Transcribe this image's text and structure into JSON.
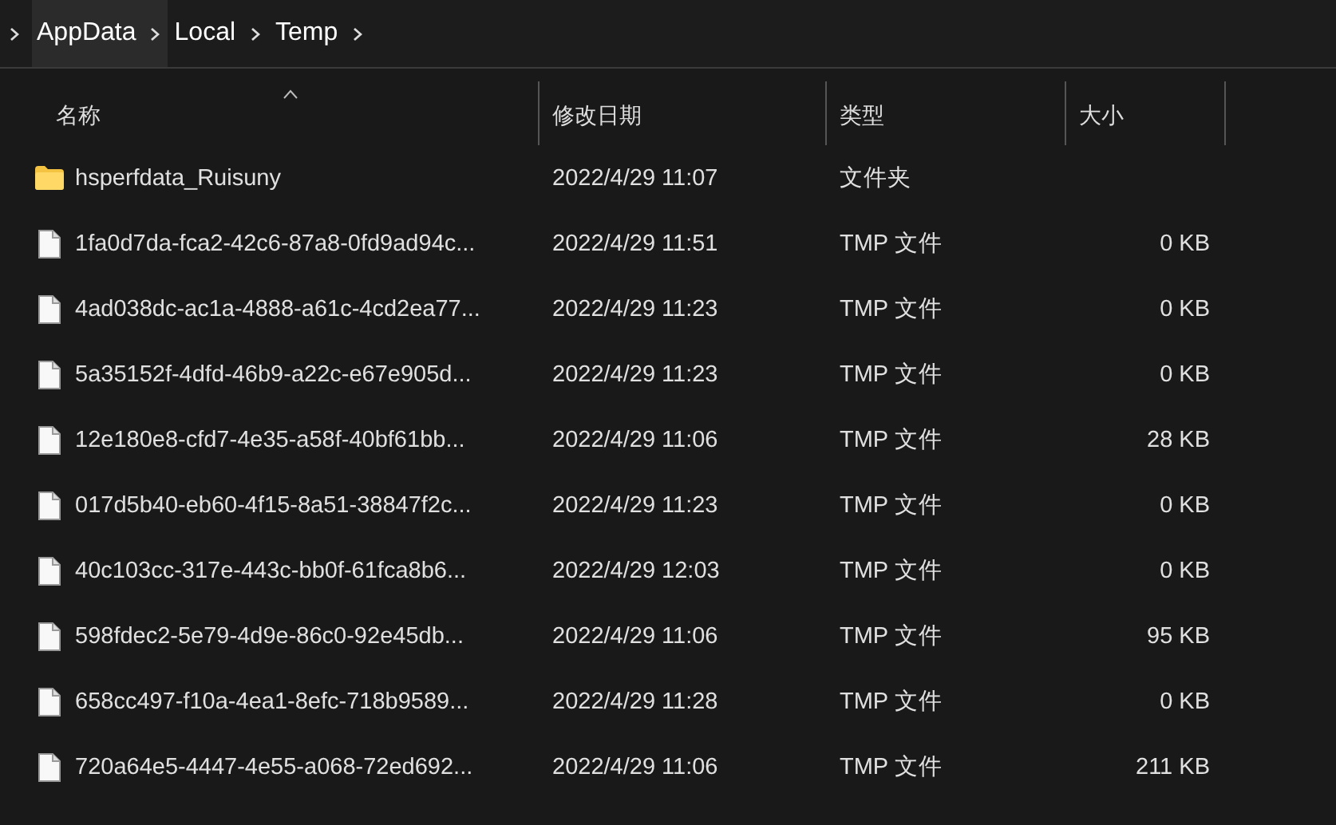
{
  "breadcrumb": [
    {
      "label": "AppData"
    },
    {
      "label": "Local"
    },
    {
      "label": "Temp"
    }
  ],
  "columns": [
    {
      "label": "名称",
      "sorted": true
    },
    {
      "label": "修改日期",
      "sorted": false
    },
    {
      "label": "类型",
      "sorted": false
    },
    {
      "label": "大小",
      "sorted": false
    }
  ],
  "rows": [
    {
      "kind": "folder",
      "name": "hsperfdata_Ruisuny",
      "modified": "2022/4/29 11:07",
      "type": "文件夹"
    },
    {
      "kind": "file",
      "name": "1fa0d7da-fca2-42c6-87a8-0fd9ad94c...",
      "modified": "2022/4/29 11:51",
      "type": "TMP 文件",
      "size": "0 KB"
    },
    {
      "kind": "file",
      "name": "4ad038dc-ac1a-4888-a61c-4cd2ea77...",
      "modified": "2022/4/29 11:23",
      "type": "TMP 文件",
      "size": "0 KB"
    },
    {
      "kind": "file",
      "name": "5a35152f-4dfd-46b9-a22c-e67e905d...",
      "modified": "2022/4/29 11:23",
      "type": "TMP 文件",
      "size": "0 KB"
    },
    {
      "kind": "file",
      "name": "12e180e8-cfd7-4e35-a58f-40bf61bb...",
      "modified": "2022/4/29 11:06",
      "type": "TMP 文件",
      "size": "28 KB"
    },
    {
      "kind": "file",
      "name": "017d5b40-eb60-4f15-8a51-38847f2c...",
      "modified": "2022/4/29 11:23",
      "type": "TMP 文件",
      "size": "0 KB"
    },
    {
      "kind": "file",
      "name": "40c103cc-317e-443c-bb0f-61fca8b6...",
      "modified": "2022/4/29 12:03",
      "type": "TMP 文件",
      "size": "0 KB"
    },
    {
      "kind": "file",
      "name": "598fdec2-5e79-4d9e-86c0-92e45db...",
      "modified": "2022/4/29 11:06",
      "type": "TMP 文件",
      "size": "95 KB"
    },
    {
      "kind": "file",
      "name": "658cc497-f10a-4ea1-8efc-718b9589...",
      "modified": "2022/4/29 11:28",
      "type": "TMP 文件",
      "size": "0 KB"
    },
    {
      "kind": "file",
      "name": "720a64e5-4447-4e55-a068-72ed692...",
      "modified": "2022/4/29 11:06",
      "type": "TMP 文件",
      "size": "211 KB"
    }
  ]
}
